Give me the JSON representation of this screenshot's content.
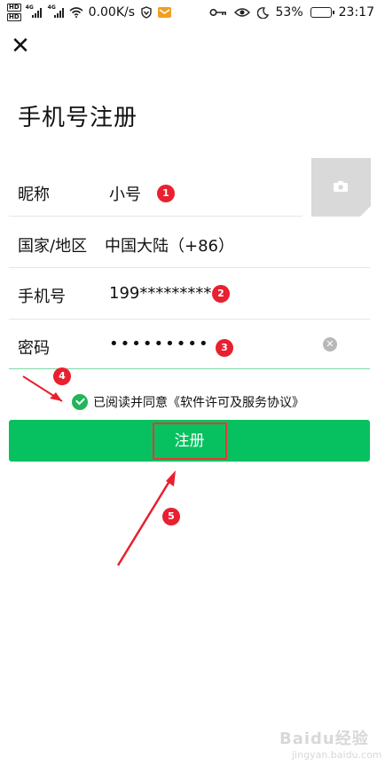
{
  "status_bar": {
    "hd1": "HD",
    "hd2": "HD",
    "net1": "4G",
    "net2": "4G",
    "speed": "0.00K/s",
    "battery": "53%",
    "time": "23:17"
  },
  "header": {
    "close_icon": "close-icon",
    "title": "手机号注册"
  },
  "form": {
    "nickname": {
      "label": "昵称",
      "value": "小号",
      "badge": "1"
    },
    "region": {
      "label": "国家/地区",
      "value": "中国大陆（+86）"
    },
    "phone": {
      "label": "手机号",
      "value": "199*********",
      "badge": "2"
    },
    "password": {
      "label": "密码",
      "value": "•••••••••",
      "badge": "3"
    }
  },
  "agreement": {
    "badge": "4",
    "text": "已阅读并同意《软件许可及服务协议》"
  },
  "register_button": {
    "label": "注册",
    "badge": "5"
  },
  "watermark": {
    "text": "Baidu经验",
    "sub": "jingyan.baidu.com"
  },
  "colors": {
    "accent_green": "#07c160",
    "check_green": "#22b55a",
    "annotation_red": "#e82030",
    "notification_orange": "#f0a020"
  }
}
